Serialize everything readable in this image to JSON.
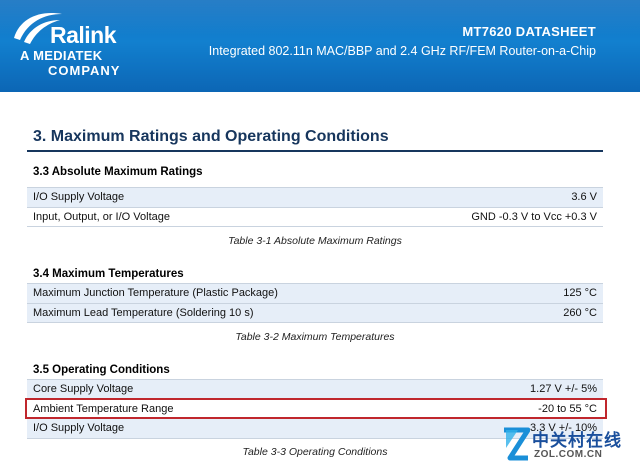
{
  "header": {
    "logo_brand": "Ralink",
    "logo_line2": "A MEDIATEK",
    "logo_line3": "COMPANY",
    "doc_title": "MT7620 DATASHEET",
    "doc_subtitle": "Integrated 802.11n MAC/BBP and 2.4 GHz RF/FEM Router-on-a-Chip",
    "colors": {
      "band": "#1280cf",
      "section_title": "#17365d",
      "highlight_box": "#c0272d"
    }
  },
  "section": {
    "title": "3. Maximum Ratings and Operating Conditions"
  },
  "tables": [
    {
      "heading": "3.3 Absolute Maximum Ratings",
      "rows": [
        {
          "label": "I/O Supply Voltage",
          "value": "3.6 V"
        },
        {
          "label": "Input, Output, or I/O Voltage",
          "value": "GND -0.3 V to Vcc +0.3 V"
        }
      ],
      "caption": "Table 3-1 Absolute Maximum Ratings"
    },
    {
      "heading": "3.4 Maximum Temperatures",
      "rows": [
        {
          "label": "Maximum Junction Temperature (Plastic Package)",
          "value": "125 °C"
        },
        {
          "label": "Maximum Lead Temperature (Soldering 10 s)",
          "value": "260 °C"
        }
      ],
      "caption": "Table 3-2 Maximum Temperatures"
    },
    {
      "heading": "3.5  Operating Conditions",
      "rows": [
        {
          "label": "Core Supply Voltage",
          "value": "1.27 V +/- 5%"
        },
        {
          "label": "Ambient Temperature Range",
          "value": "-20 to 55 °C"
        },
        {
          "label": "I/O Supply Voltage",
          "value": "3.3 V +/- 10%"
        }
      ],
      "caption": "Table 3-3 Operating Conditions"
    }
  ],
  "watermark": {
    "cn": "中关村在线",
    "en": "ZOL.COM.CN",
    "icon": "zol-logo-icon"
  }
}
